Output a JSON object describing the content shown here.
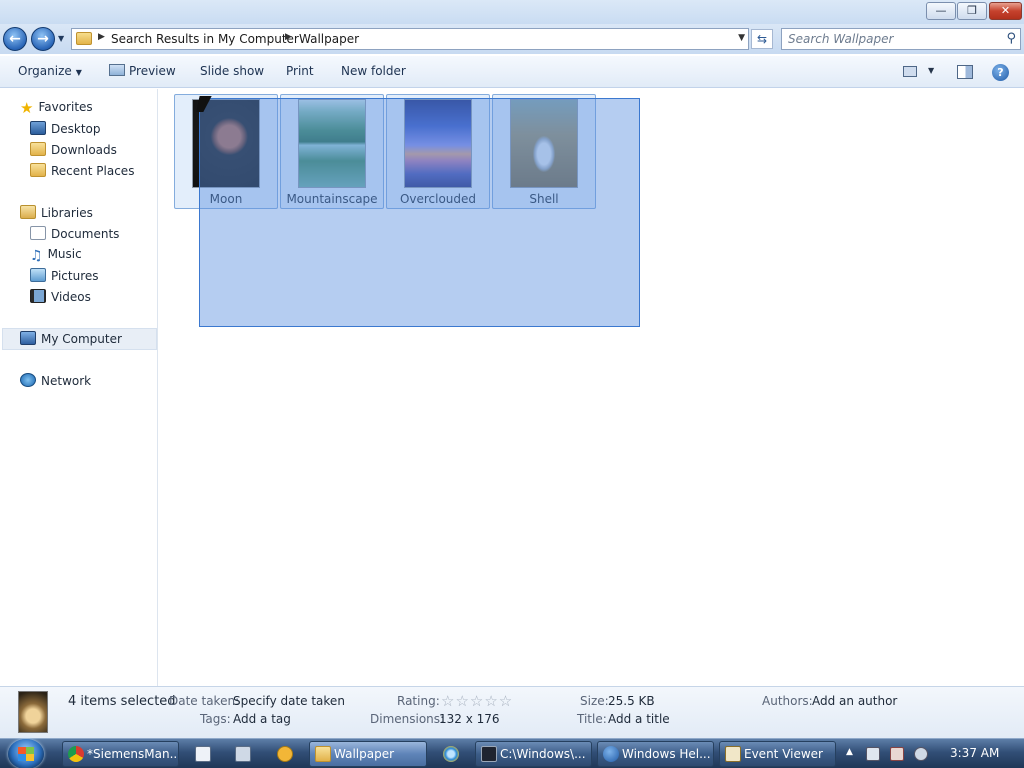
{
  "window": {
    "caption_buttons": {
      "minimize": "—",
      "maximize": "❐",
      "close": "✕"
    }
  },
  "address": {
    "crumbs": [
      "Search Results in My Computer",
      "Wallpaper"
    ],
    "search_placeholder": "Search Wallpaper"
  },
  "toolbar": {
    "organize": "Organize",
    "preview": "Preview",
    "slideshow": "Slide show",
    "print": "Print",
    "new_folder": "New folder",
    "help": "?"
  },
  "nav": {
    "favorites": "Favorites",
    "desktop": "Desktop",
    "downloads": "Downloads",
    "recent_places": "Recent Places",
    "libraries": "Libraries",
    "documents": "Documents",
    "music": "Music",
    "pictures": "Pictures",
    "videos": "Videos",
    "my_computer": "My Computer",
    "network": "Network"
  },
  "files": [
    {
      "name": "Moon",
      "icon": "moon-thumbnail"
    },
    {
      "name": "Mountainscape",
      "icon": "mountain-thumbnail"
    },
    {
      "name": "Overclouded",
      "icon": "clouds-thumbnail"
    },
    {
      "name": "Shell",
      "icon": "shell-thumbnail"
    }
  ],
  "details": {
    "count": "4 items selected",
    "date_taken_label": "Date taken:",
    "date_taken_value": "Specify date taken",
    "tags_label": "Tags:",
    "tags_value": "Add a tag",
    "rating_label": "Rating:",
    "rating_stars": "☆☆☆☆☆",
    "rating_value": 0,
    "dimensions_label": "Dimensions:",
    "dimensions_value": "132 x 176",
    "size_label": "Size:",
    "size_value": "25.5 KB",
    "title_label": "Title:",
    "title_value": "Add a title",
    "authors_label": "Authors:",
    "authors_value": "Add an author"
  },
  "taskbar": {
    "buttons": [
      {
        "label": "*SiemensMan...",
        "icon": "chrome-icon"
      },
      {
        "label": "Wallpaper",
        "icon": "folder-icon",
        "active": true
      },
      {
        "label": "C:\\Windows\\...",
        "icon": "cmd-icon"
      },
      {
        "label": "Windows Hel...",
        "icon": "help-icon"
      },
      {
        "label": "Event Viewer",
        "icon": "event-viewer-icon"
      }
    ],
    "clock": "3:37 AM"
  },
  "colors": {
    "selection": "#5a91e1",
    "taskbar": "#324f77",
    "close_button": "#c6422d"
  }
}
